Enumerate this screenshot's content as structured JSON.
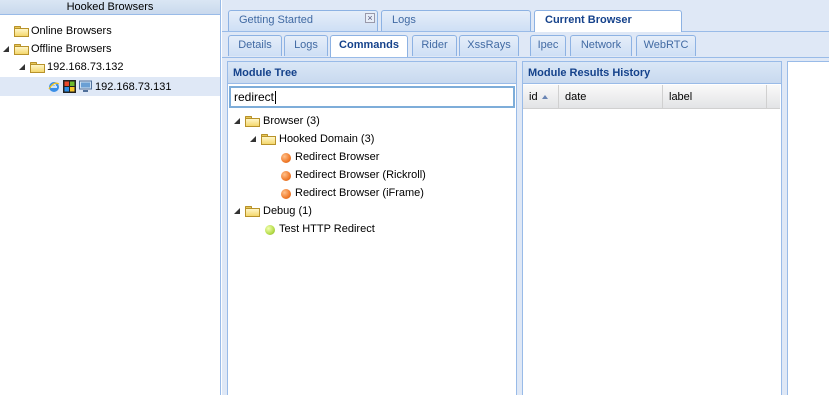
{
  "left": {
    "header": "Hooked Browsers",
    "online_label": "Online Browsers",
    "offline_label": "Offline Browsers",
    "ip_group": "192.168.73.132",
    "ip_item": "192.168.73.131"
  },
  "top_tabs": [
    {
      "label": "Getting Started"
    },
    {
      "label": "Logs"
    },
    {
      "label": "Current Browser"
    }
  ],
  "sub_tabs": [
    {
      "label": "Details"
    },
    {
      "label": "Logs"
    },
    {
      "label": "Commands"
    },
    {
      "label": "Rider"
    },
    {
      "label": "XssRays"
    },
    {
      "label": "Ipec"
    },
    {
      "label": "Network"
    },
    {
      "label": "WebRTC"
    }
  ],
  "module_tree": {
    "title": "Module Tree",
    "search_value": "redirect",
    "nodes": {
      "browser": "Browser (3)",
      "hooked_domain": "Hooked Domain (3)",
      "redirect_browser": "Redirect Browser",
      "redirect_rickroll": "Redirect Browser (Rickroll)",
      "redirect_iframe": "Redirect Browser (iFrame)",
      "debug": "Debug (1)",
      "test_http_redirect": "Test HTTP Redirect"
    }
  },
  "results": {
    "title": "Module Results History",
    "columns": [
      "id",
      "date",
      "label"
    ]
  },
  "colors": {
    "accent": "#15428b",
    "border": "#99bbe8",
    "status_orange": "#f07a2a",
    "status_green": "#b5dc4a"
  }
}
